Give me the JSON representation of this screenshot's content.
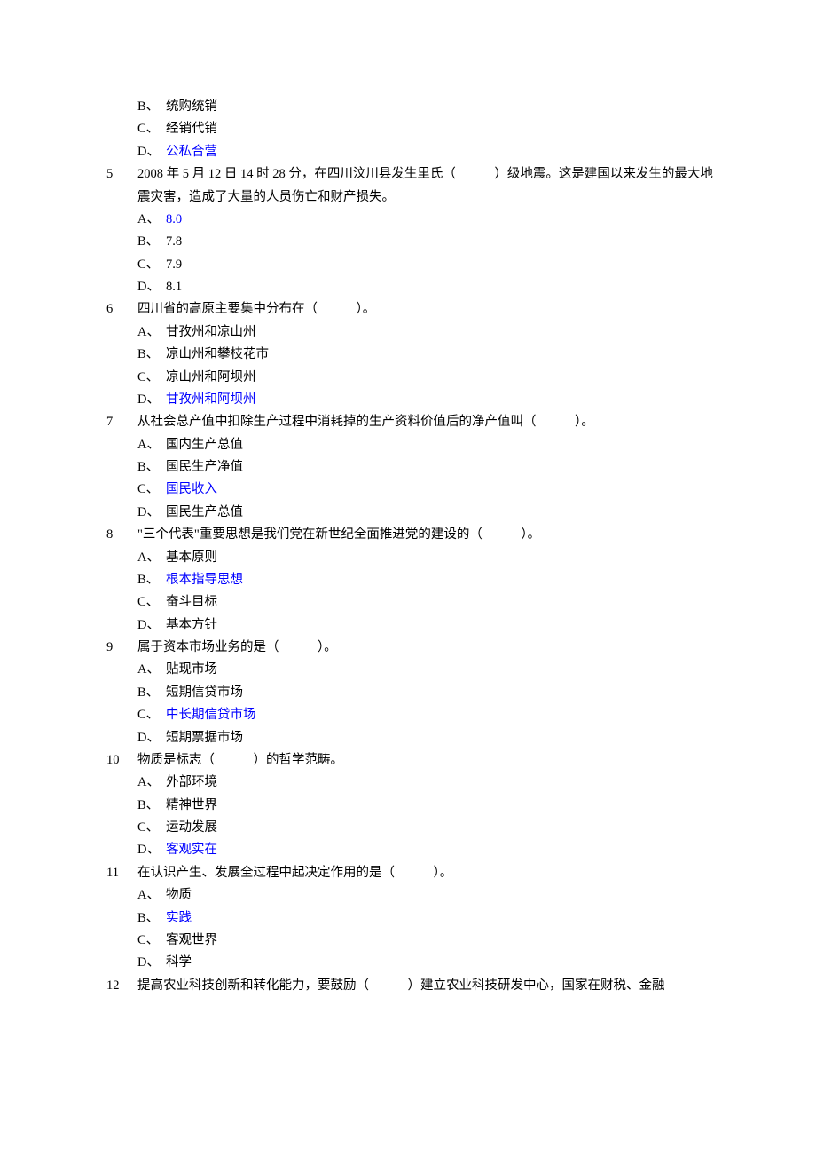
{
  "orphan_options": [
    {
      "label": "B、",
      "text": "统购统销",
      "blue": false
    },
    {
      "label": "C、",
      "text": "经销代销",
      "blue": false
    },
    {
      "label": "D、",
      "text": "公私合营",
      "blue": true
    }
  ],
  "questions": [
    {
      "num": "5",
      "text": "2008 年 5 月 12 日 14 时 28 分，在四川汶川县发生里氏（　　　）级地震。这是建国以来发生的最大地震灾害，造成了大量的人员伤亡和财产损失。",
      "options": [
        {
          "label": "A、",
          "text": "8.0",
          "blue": true
        },
        {
          "label": "B、",
          "text": "7.8",
          "blue": false
        },
        {
          "label": "C、",
          "text": "7.9",
          "blue": false
        },
        {
          "label": "D、",
          "text": "8.1",
          "blue": false
        }
      ]
    },
    {
      "num": "6",
      "text": "四川省的高原主要集中分布在（　　　）。",
      "options": [
        {
          "label": "A、",
          "text": "甘孜州和凉山州",
          "blue": false
        },
        {
          "label": "B、",
          "text": "凉山州和攀枝花市",
          "blue": false
        },
        {
          "label": "C、",
          "text": "凉山州和阿坝州",
          "blue": false
        },
        {
          "label": "D、",
          "text": "甘孜州和阿坝州",
          "blue": true
        }
      ]
    },
    {
      "num": "7",
      "text": "从社会总产值中扣除生产过程中消耗掉的生产资料价值后的净产值叫（　　　）。",
      "options": [
        {
          "label": "A、",
          "text": "国内生产总值",
          "blue": false
        },
        {
          "label": "B、",
          "text": "国民生产净值",
          "blue": false
        },
        {
          "label": "C、",
          "text": "国民收入",
          "blue": true
        },
        {
          "label": "D、",
          "text": "国民生产总值",
          "blue": false
        }
      ]
    },
    {
      "num": "8",
      "text": "\"三个代表\"重要思想是我们党在新世纪全面推进党的建设的（　　　）。",
      "options": [
        {
          "label": "A、",
          "text": "基本原则",
          "blue": false
        },
        {
          "label": "B、",
          "text": "根本指导思想",
          "blue": true
        },
        {
          "label": "C、",
          "text": "奋斗目标",
          "blue": false
        },
        {
          "label": "D、",
          "text": "基本方针",
          "blue": false
        }
      ]
    },
    {
      "num": "9",
      "text": "属于资本市场业务的是（　　　）。",
      "options": [
        {
          "label": "A、",
          "text": "贴现市场",
          "blue": false
        },
        {
          "label": "B、",
          "text": "短期信贷市场",
          "blue": false
        },
        {
          "label": "C、",
          "text": "中长期信贷市场",
          "blue": true
        },
        {
          "label": "D、",
          "text": "短期票据市场",
          "blue": false
        }
      ]
    },
    {
      "num": "10",
      "text": "物质是标志（　　　）的哲学范畴。",
      "options": [
        {
          "label": "A、",
          "text": "外部环境",
          "blue": false
        },
        {
          "label": "B、",
          "text": "精神世界",
          "blue": false
        },
        {
          "label": "C、",
          "text": "运动发展",
          "blue": false
        },
        {
          "label": "D、",
          "text": "客观实在",
          "blue": true
        }
      ]
    },
    {
      "num": "11",
      "text": "在认识产生、发展全过程中起决定作用的是（　　　）。",
      "options": [
        {
          "label": "A、",
          "text": "物质",
          "blue": false
        },
        {
          "label": "B、",
          "text": "实践",
          "blue": true
        },
        {
          "label": "C、",
          "text": "客观世界",
          "blue": false
        },
        {
          "label": "D、",
          "text": "科学",
          "blue": false
        }
      ]
    },
    {
      "num": "12",
      "text": "提高农业科技创新和转化能力，要鼓励（　　　）建立农业科技研发中心，国家在财税、金融",
      "options": []
    }
  ]
}
